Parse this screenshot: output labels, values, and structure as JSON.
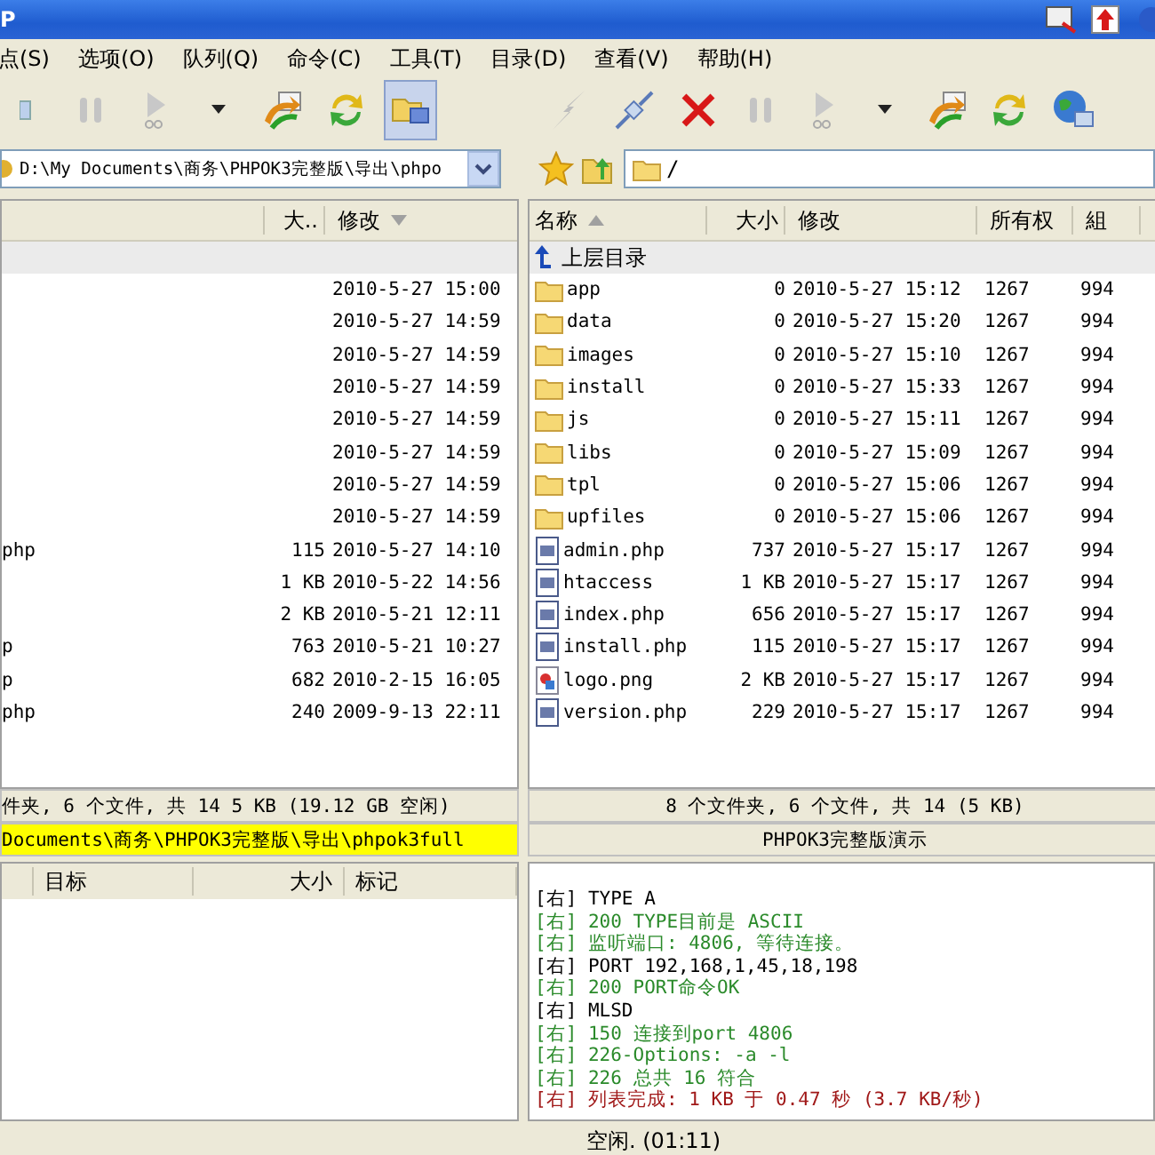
{
  "window": {
    "title": "P"
  },
  "menu": [
    "点(S)",
    "选项(O)",
    "队列(Q)",
    "命令(C)",
    "工具(T)",
    "目录(D)",
    "查看(V)",
    "帮助(H)"
  ],
  "left_toolbar": [
    {
      "kind": "partial",
      "selected": false
    },
    {
      "kind": "pause",
      "selected": false
    },
    {
      "kind": "go",
      "selected": false
    },
    {
      "kind": "dropdown",
      "selected": false
    },
    {
      "kind": "transfer",
      "selected": false
    },
    {
      "kind": "refresh",
      "selected": false
    },
    {
      "kind": "sites",
      "selected": true
    }
  ],
  "right_toolbar": [
    {
      "kind": "connect"
    },
    {
      "kind": "disconnect"
    },
    {
      "kind": "abort"
    },
    {
      "kind": "pause"
    },
    {
      "kind": "go"
    },
    {
      "kind": "dropdown"
    },
    {
      "kind": "transfer"
    },
    {
      "kind": "refresh"
    },
    {
      "kind": "globe"
    }
  ],
  "left_path": "D:\\My Documents\\商务\\PHPOK3完整版\\导出\\phpo",
  "right_path": "/",
  "left_pane": {
    "columns": [
      {
        "label": "大..",
        "kind": "plain"
      },
      {
        "label": "修改",
        "kind": "sort-down"
      }
    ],
    "rows": [
      {
        "name": "",
        "size": "",
        "modified": "2010-5-27 15:00"
      },
      {
        "name": "",
        "size": "",
        "modified": "2010-5-27 14:59"
      },
      {
        "name": "",
        "size": "",
        "modified": "2010-5-27 14:59"
      },
      {
        "name": "",
        "size": "",
        "modified": "2010-5-27 14:59"
      },
      {
        "name": "",
        "size": "",
        "modified": "2010-5-27 14:59"
      },
      {
        "name": "",
        "size": "",
        "modified": "2010-5-27 14:59"
      },
      {
        "name": "",
        "size": "",
        "modified": "2010-5-27 14:59"
      },
      {
        "name": "",
        "size": "",
        "modified": "2010-5-27 14:59"
      },
      {
        "name": "php",
        "size": "115",
        "modified": "2010-5-27 14:10"
      },
      {
        "name": "",
        "size": "1 KB",
        "modified": "2010-5-22 14:56"
      },
      {
        "name": "",
        "size": "2 KB",
        "modified": "2010-5-21 12:11"
      },
      {
        "name": "p",
        "size": "763",
        "modified": "2010-5-21 10:27"
      },
      {
        "name": "p",
        "size": "682",
        "modified": "2010-2-15 16:05"
      },
      {
        "name": "php",
        "size": "240",
        "modified": "2009-9-13 22:11"
      }
    ],
    "status": "件夹, 6 个文件, 共 14 5 KB (19.12 GB 空闲)",
    "path_status": "Documents\\商务\\PHPOK3完整版\\导出\\phpok3full"
  },
  "right_pane": {
    "columns": [
      {
        "label": "名称",
        "kind": "sort-up"
      },
      {
        "label": "大小",
        "kind": "plain"
      },
      {
        "label": "修改",
        "kind": "plain"
      },
      {
        "label": "所有权",
        "kind": "plain"
      },
      {
        "label": "組",
        "kind": "plain"
      }
    ],
    "parent_row": "上层目录",
    "rows": [
      {
        "kind": "folder",
        "name": "app",
        "size": "0",
        "modified": "2010-5-27 15:12",
        "owner": "1267",
        "group": "994"
      },
      {
        "kind": "folder",
        "name": "data",
        "size": "0",
        "modified": "2010-5-27 15:20",
        "owner": "1267",
        "group": "994"
      },
      {
        "kind": "folder",
        "name": "images",
        "size": "0",
        "modified": "2010-5-27 15:10",
        "owner": "1267",
        "group": "994"
      },
      {
        "kind": "folder",
        "name": "install",
        "size": "0",
        "modified": "2010-5-27 15:33",
        "owner": "1267",
        "group": "994"
      },
      {
        "kind": "folder",
        "name": "js",
        "size": "0",
        "modified": "2010-5-27 15:11",
        "owner": "1267",
        "group": "994"
      },
      {
        "kind": "folder",
        "name": "libs",
        "size": "0",
        "modified": "2010-5-27 15:09",
        "owner": "1267",
        "group": "994"
      },
      {
        "kind": "folder",
        "name": "tpl",
        "size": "0",
        "modified": "2010-5-27 15:06",
        "owner": "1267",
        "group": "994"
      },
      {
        "kind": "folder",
        "name": "upfiles",
        "size": "0",
        "modified": "2010-5-27 15:06",
        "owner": "1267",
        "group": "994"
      },
      {
        "kind": "file",
        "name": "admin.php",
        "size": "737",
        "modified": "2010-5-27 15:17",
        "owner": "1267",
        "group": "994"
      },
      {
        "kind": "file",
        "name": "htaccess",
        "size": "1 KB",
        "modified": "2010-5-27 15:17",
        "owner": "1267",
        "group": "994"
      },
      {
        "kind": "file",
        "name": "index.php",
        "size": "656",
        "modified": "2010-5-27 15:17",
        "owner": "1267",
        "group": "994"
      },
      {
        "kind": "file",
        "name": "install.php",
        "size": "115",
        "modified": "2010-5-27 15:17",
        "owner": "1267",
        "group": "994"
      },
      {
        "kind": "image",
        "name": "logo.png",
        "size": "2 KB",
        "modified": "2010-5-27 15:17",
        "owner": "1267",
        "group": "994"
      },
      {
        "kind": "file",
        "name": "version.php",
        "size": "229",
        "modified": "2010-5-27 15:17",
        "owner": "1267",
        "group": "994"
      }
    ],
    "status": "8 个文件夹, 6 个文件, 共 14 (5 KB)",
    "site_status": "PHPOK3完整版演示"
  },
  "queue": {
    "columns": [
      "目标",
      "大小",
      "标记"
    ]
  },
  "log": [
    {
      "kind": "command",
      "text": "[右] TYPE A"
    },
    {
      "kind": "reply",
      "text": "[右] 200 TYPE目前是 ASCII"
    },
    {
      "kind": "reply",
      "text": "[右] 监听端口: 4806, 等待连接。"
    },
    {
      "kind": "command",
      "text": "[右] PORT 192,168,1,45,18,198"
    },
    {
      "kind": "reply",
      "text": "[右] 200 PORT命令OK"
    },
    {
      "kind": "command",
      "text": "[右] MLSD"
    },
    {
      "kind": "reply",
      "text": "[右] 150 连接到port 4806"
    },
    {
      "kind": "reply",
      "text": "[右] 226-Options: -a -l"
    },
    {
      "kind": "reply",
      "text": "[右] 226 总共 16 符合"
    },
    {
      "kind": "done",
      "text": "[右] 列表完成: 1 KB 于 0.47 秒 (3.7 KB/秒)"
    }
  ],
  "status_bar": "空闲. (01:11)"
}
